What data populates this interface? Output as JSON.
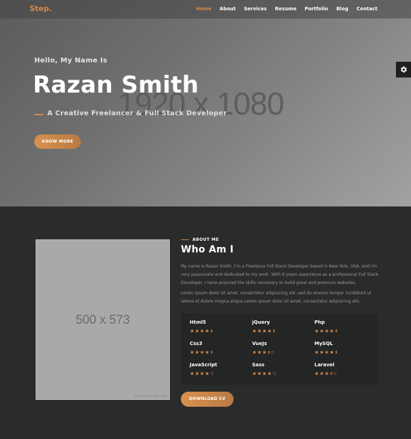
{
  "nav": {
    "logo": "Step.",
    "items": [
      {
        "label": "Home",
        "active": true
      },
      {
        "label": "About",
        "active": false
      },
      {
        "label": "Services",
        "active": false
      },
      {
        "label": "Resume",
        "active": false
      },
      {
        "label": "Portfolio",
        "active": false
      },
      {
        "label": "Blog",
        "active": false
      },
      {
        "label": "Contact",
        "active": false
      }
    ]
  },
  "hero": {
    "placeholder": "1920 x 1080",
    "greeting": "Hello, My Name Is",
    "name": "Razan Smith",
    "subtitle": "A Creative Freelancer & Full Stack Developer",
    "button": "KNOW MORE",
    "settings_icon": "gear-icon"
  },
  "about": {
    "image_placeholder": "500 x 573",
    "image_credit": "Powered by HTML.COM",
    "tag": "ABOUT ME",
    "title": "Who Am I",
    "paragraph1": "My name is Razan Smith. I'm a Freelance Full Stack Developer based in New York, USA, and I'm very passionate and dedicated to my work .With 6 years experience as a professional Full Stack Developer, I have acquired the skills necessary to build great and premium websites.",
    "paragraph2": "Lorem ipsum dolor sit amet, consectetur adipisicing elit, sed do eiusmo tempor incididunt ut labore et dolore magna aliqua Lorem ipsum dolor sit amet, consectetur adipisicing elit.",
    "button": "DOWNLOAD CV",
    "skills": [
      {
        "name": "Html5",
        "rating": 4.5
      },
      {
        "name": "jQuery",
        "rating": 4.5
      },
      {
        "name": "Php",
        "rating": 4.5
      },
      {
        "name": "Css3",
        "rating": 4.5
      },
      {
        "name": "VueJs",
        "rating": 3.5
      },
      {
        "name": "MySQL",
        "rating": 4.5
      },
      {
        "name": "JavaScript",
        "rating": 4
      },
      {
        "name": "Sass",
        "rating": 4
      },
      {
        "name": "Laravel",
        "rating": 3.5
      }
    ]
  },
  "colors": {
    "accent": "#d4894a",
    "hero_bg": "#6f6f6f",
    "section_bg": "#2a2b2b",
    "skills_bg": "#242525"
  }
}
